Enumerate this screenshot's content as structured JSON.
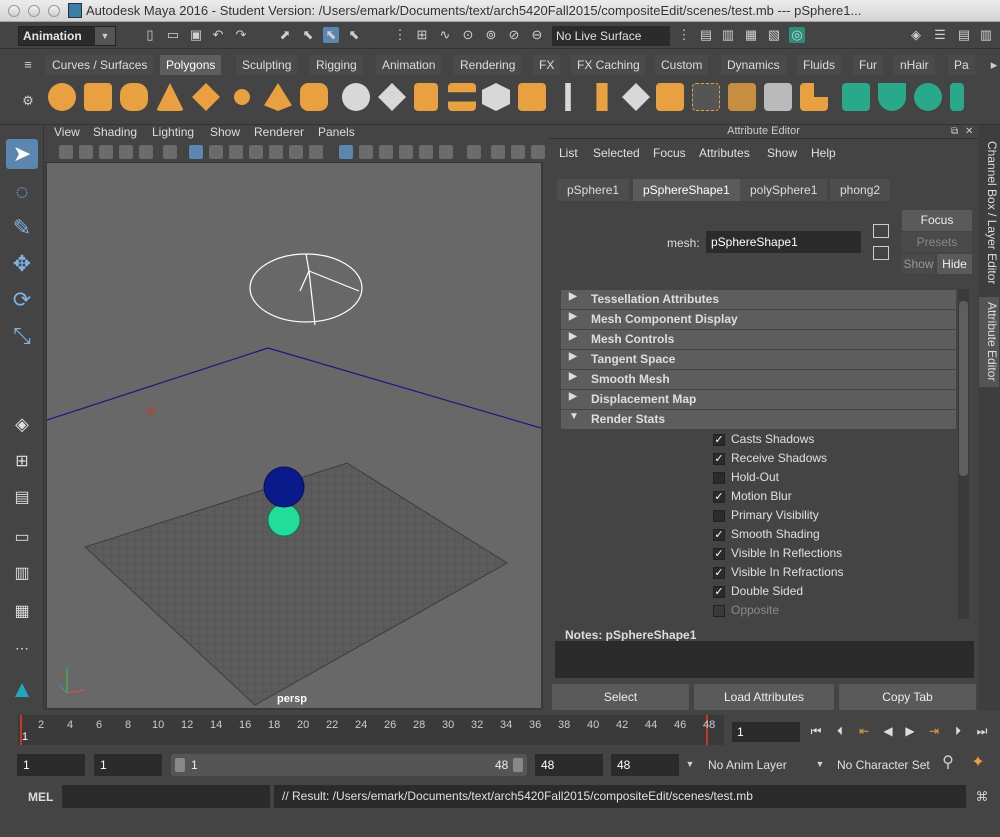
{
  "window": {
    "title": "Autodesk Maya 2016 - Student Version: /Users/emark/Documents/text/arch5420Fall2015/compositeEdit/scenes/test.mb   ---   pSphere1..."
  },
  "status_line": {
    "menu_set": "Animation",
    "live_surface": "No Live Surface"
  },
  "shelf": {
    "tabs": [
      "Curves / Surfaces",
      "Polygons",
      "Sculpting",
      "Rigging",
      "Animation",
      "Rendering",
      "FX",
      "FX Caching",
      "Custom",
      "Dynamics",
      "Fluids",
      "Fur",
      "nHair",
      "Pa"
    ],
    "active_tab": "Polygons"
  },
  "viewport": {
    "menus": [
      "View",
      "Shading",
      "Lighting",
      "Show",
      "Renderer",
      "Panels"
    ],
    "camera_label": "persp"
  },
  "attribute_editor": {
    "title": "Attribute Editor",
    "menus": [
      "List",
      "Selected",
      "Focus",
      "Attributes",
      "Show",
      "Help"
    ],
    "tabs": [
      "pSphere1",
      "pSphereShape1",
      "polySphere1",
      "phong2"
    ],
    "active_tab": "pSphereShape1",
    "mesh_label": "mesh:",
    "mesh_value": "pSphereShape1",
    "focus_label": "Focus",
    "presets_label": "Presets",
    "show_label": "Show",
    "hide_label": "Hide",
    "sections": [
      "Tessellation Attributes",
      "Mesh Component Display",
      "Mesh Controls",
      "Tangent Space",
      "Smooth Mesh",
      "Displacement Map",
      "Render Stats"
    ],
    "render_stats": [
      {
        "label": "Casts Shadows",
        "checked": "✓"
      },
      {
        "label": "Receive Shadows",
        "checked": "✓"
      },
      {
        "label": "Hold-Out",
        "checked": ""
      },
      {
        "label": "Motion Blur",
        "checked": "✓"
      },
      {
        "label": "Primary Visibility",
        "checked": ""
      },
      {
        "label": "Smooth Shading",
        "checked": "✓"
      },
      {
        "label": "Visible In Reflections",
        "checked": "✓"
      },
      {
        "label": "Visible In Refractions",
        "checked": "✓"
      },
      {
        "label": "Double Sided",
        "checked": "✓"
      },
      {
        "label": "Opposite",
        "checked": ""
      }
    ],
    "notes_label": "Notes:  pSphereShape1",
    "buttons": [
      "Select",
      "Load Attributes",
      "Copy Tab"
    ]
  },
  "side_tabs": [
    "Channel Box / Layer Editor",
    "Attribute Editor"
  ],
  "time_slider": {
    "ticks": [
      "2",
      "4",
      "6",
      "8",
      "10",
      "12",
      "14",
      "16",
      "18",
      "20",
      "22",
      "24",
      "26",
      "28",
      "30",
      "32",
      "34",
      "36",
      "38",
      "40",
      "42",
      "44",
      "46",
      "48"
    ],
    "start_frame": "1",
    "current_frame": "1"
  },
  "range_slider": {
    "start": "1",
    "playback_start": "1",
    "range_start": "1",
    "range_end": "48",
    "playback_end": "48",
    "end": "48",
    "anim_layer": "No Anim Layer",
    "character_set": "No Character Set"
  },
  "command_line": {
    "label": "MEL",
    "result": "// Result: /Users/emark/Documents/text/arch5420Fall2015/compositeEdit/scenes/test.mb"
  },
  "colors": {
    "panel": "#444444",
    "field": "#2b2b2b",
    "viewport_bg": "#686868",
    "sphere_blue": "#0a1a8a",
    "sphere_green": "#22dd99",
    "shelf_icon_orange": "#e8a040",
    "shelf_icon_teal": "#2aa88a"
  }
}
